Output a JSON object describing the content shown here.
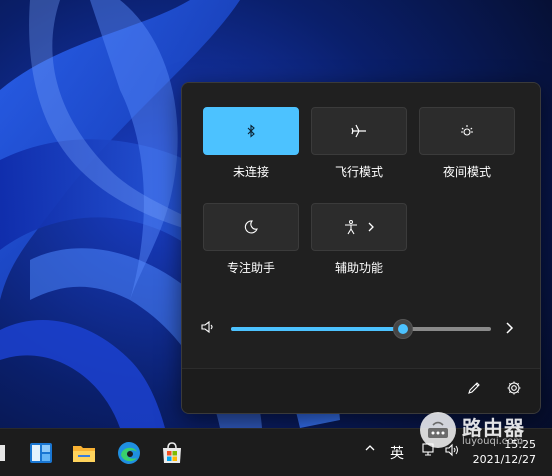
{
  "quick_settings": {
    "tiles": [
      {
        "label": "未连接",
        "icon": "bluetooth-icon",
        "active": true
      },
      {
        "label": "飞行模式",
        "icon": "airplane-icon",
        "active": false
      },
      {
        "label": "夜间模式",
        "icon": "night-light-icon",
        "active": false
      },
      {
        "label": "专注助手",
        "icon": "focus-assist-moon-icon",
        "active": false
      },
      {
        "label": "辅助功能",
        "icon": "accessibility-icon",
        "active": false
      }
    ],
    "volume": {
      "level_percent": 66,
      "icon": "speaker-icon"
    },
    "footer": {
      "edit_icon": "pencil-icon",
      "settings_icon": "gear-icon"
    }
  },
  "taskbar": {
    "apps": [
      "start-partial",
      "widgets-icon",
      "file-explorer-icon",
      "edge-icon",
      "microsoft-store-icon"
    ],
    "tray": {
      "language": "英",
      "time": "15:25",
      "date": "2021/12/27"
    }
  },
  "watermark": {
    "text": "路由器",
    "url": "luyouqi.com"
  },
  "colors": {
    "accent": "#4cc2ff",
    "panel_bg": "#202020",
    "tile_bg": "#2c2c2c"
  }
}
